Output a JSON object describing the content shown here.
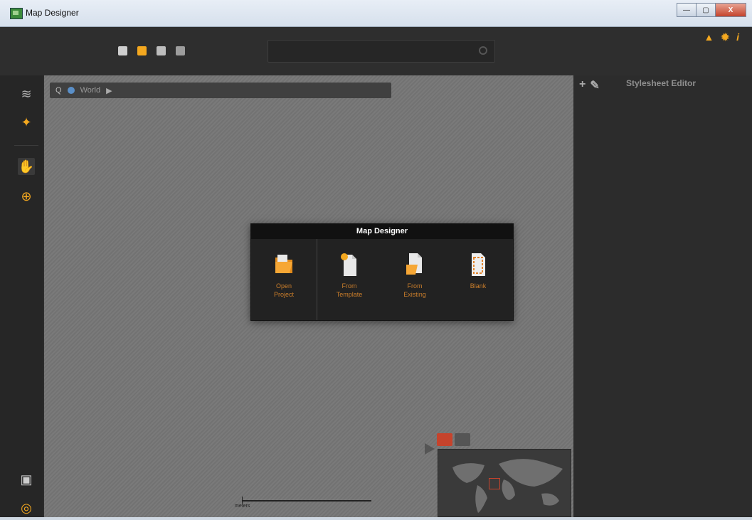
{
  "window": {
    "title": "Map Designer"
  },
  "crumb": {
    "text": "World"
  },
  "dialog": {
    "title": "Map Designer",
    "options": [
      {
        "label1": "Open",
        "label2": "Project"
      },
      {
        "label1": "From",
        "label2": "Template"
      },
      {
        "label1": "From",
        "label2": "Existing"
      },
      {
        "label1": "Blank",
        "label2": ""
      }
    ]
  },
  "right_panel": {
    "title": "Stylesheet Editor",
    "add": "+",
    "edit": "✎"
  },
  "scale": {
    "label": "meters"
  },
  "top_right": {
    "alert": "▲",
    "settings": "✹",
    "info": "i"
  }
}
